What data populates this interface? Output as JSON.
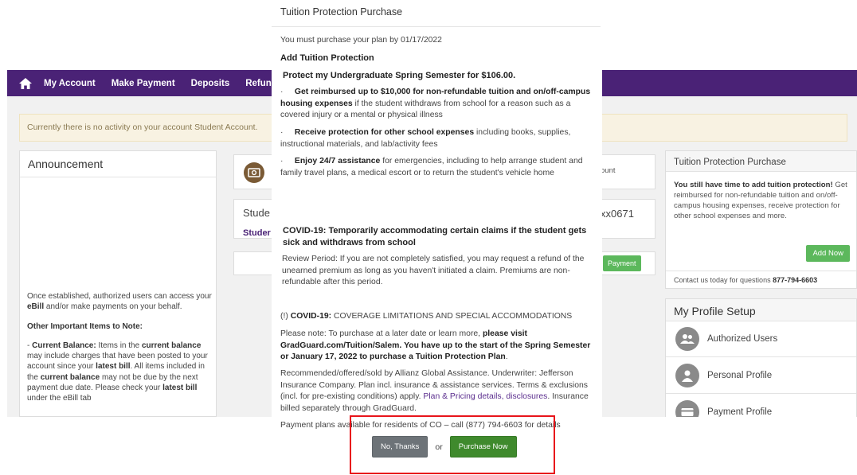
{
  "portal": {
    "nav": [
      "My Account",
      "Make Payment",
      "Deposits",
      "Refund"
    ],
    "notice": "Currently there is no activity on your account Student Account.",
    "announcement": {
      "title": "Announcement",
      "p1_pre": "Once established, authorized users can access your ",
      "p1_bold": "eBill",
      "p1_post": " and/or make payments on your behalf.",
      "other_title": "Other Important Items to Note:",
      "cb_pre": "- ",
      "cb_label": "Current Balance:",
      "cb_t1": " Items in the ",
      "cb_b1": "current balance",
      "cb_t2": " may include charges that have been posted to your account since your ",
      "cb_b2": "latest bill",
      "cb_t3": ". All items included in the ",
      "cb_b3": "current balance",
      "cb_t4": " may not be due by the next payment due date. Please check your ",
      "cb_b4": "latest bill",
      "cb_t5": " under the eBill tab"
    },
    "mid": {
      "student_title": "Stude",
      "student_link": "Studer"
    },
    "right_partial": {
      "account": "ount",
      "number": "xx0671",
      "payment": "Payment"
    },
    "tuition_card": {
      "title": "Tuition Protection Purchase",
      "bold": "You still have time to add tuition protection!",
      "text": " Get reimbursed for non-refundable tuition and on/off-campus housing expenses, receive protection for other school expenses and more.",
      "add_button": "Add Now",
      "contact_pre": "Contact us today for questions ",
      "contact_phone": "877-794-6603"
    },
    "profile": {
      "title": "My Profile Setup",
      "items": [
        "Authorized Users",
        "Personal Profile",
        "Payment Profile"
      ]
    }
  },
  "modal": {
    "title": "Tuition Protection Purchase",
    "deadline": "You must purchase your plan by 01/17/2022",
    "add_heading": "Add Tuition Protection",
    "protect_line": "Protect my Undergraduate Spring Semester for $106.00.",
    "bullet1_bold": "Get reimbursed up to $10,000 for non-refundable tuition and on/off-campus housing expenses",
    "bullet1_text": " if the student withdraws from school for a reason such as a covered injury or a mental or physical illness",
    "bullet2_bold": "Receive protection for other school expenses",
    "bullet2_text": " including books, supplies, instructional materials, and lab/activity fees",
    "bullet3_bold": "Enjoy 24/7 assistance",
    "bullet3_text": " for emergencies, including to help arrange student and family travel plans, a medical escort or to return the student's vehicle home",
    "covid_heading": "COVID-19: Temporarily accommodating certain claims if the student gets sick and withdraws from school",
    "review": "Review Period: If you are not completely satisfied, you may request a refund of the unearned premium as long as you haven't initiated a claim. Premiums are non-refundable after this period.",
    "covid2_prefix": "(!) ",
    "covid2_bold": "COVID-19:",
    "covid2_text": " COVERAGE LIMITATIONS AND SPECIAL ACCOMMODATIONS",
    "note_pre": "Please note: To purchase at a later date or learn more, ",
    "note_bold1": "please visit GradGuard.com/Tuition/Salem.",
    "note_mid": " ",
    "note_bold2": "You have up to the start of the Spring Semester or January 17, 2022 to purchase a Tuition Protection Plan",
    "note_end": ".",
    "legal_pre": "Recommended/offered/sold by Allianz Global Assistance. Underwriter: Jefferson Insurance Company. Plan incl. insurance & assistance services. Terms & exclusions (incl. for pre-existing conditions) apply. ",
    "legal_link": "Plan & Pricing details, disclosures",
    "legal_post": ". Insurance billed separately through GradGuard.",
    "payment_plans": "Payment plans available for residents of CO – call (877) 794-6603 for details",
    "no_thanks": "No, Thanks",
    "or": "or",
    "purchase_now": "Purchase Now"
  },
  "colors": {
    "nav_purple": "#4a2276",
    "primary_green": "#3f8a2d",
    "highlight_red": "#e8141b"
  }
}
